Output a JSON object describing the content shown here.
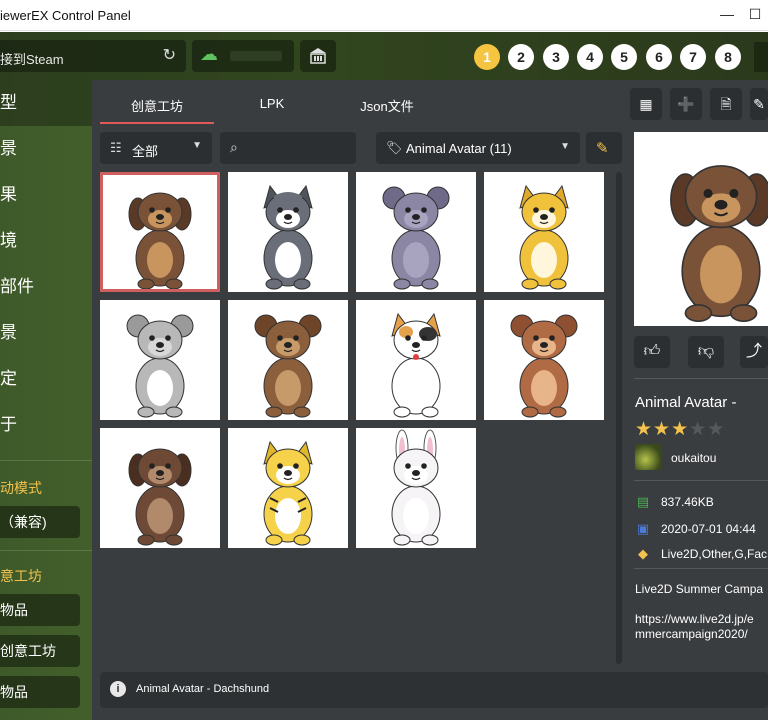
{
  "window": {
    "title": "iewerEX Control Panel",
    "minimize": "—",
    "maximize": "☐"
  },
  "topbar": {
    "steam_status": "接到Steam",
    "profile_numbers": [
      "1",
      "2",
      "3",
      "4",
      "5",
      "6",
      "7",
      "8"
    ],
    "active_profile": "1"
  },
  "sidebar": {
    "items": [
      "型",
      "景",
      "果",
      "境",
      "部件",
      "景",
      "定",
      "于"
    ],
    "active_index": 0,
    "mode_section_label": "动模式",
    "mode_button": "（兼容)",
    "workshop_section_label": "意工坊",
    "workshop_buttons": [
      "物品",
      "创意工坊",
      "物品"
    ]
  },
  "tabs": [
    "创意工坊",
    "LPK",
    "Json文件"
  ],
  "active_tab": "创意工坊",
  "filters": {
    "category": "全部",
    "search_placeholder": "",
    "tag_filter": "Animal Avatar (11)"
  },
  "grid": {
    "items": [
      {
        "name": "Dachshund",
        "animal": "dog"
      },
      {
        "name": "Husky",
        "animal": "husky"
      },
      {
        "name": "Hippo",
        "animal": "hippo"
      },
      {
        "name": "Fox",
        "animal": "fox"
      },
      {
        "name": "Koala",
        "animal": "koala"
      },
      {
        "name": "Bear",
        "animal": "bear"
      },
      {
        "name": "Cat",
        "animal": "cat"
      },
      {
        "name": "Monkey",
        "animal": "monkey"
      },
      {
        "name": "Tanuki",
        "animal": "tanuki"
      },
      {
        "name": "Tiger",
        "animal": "tiger"
      },
      {
        "name": "Rabbit",
        "animal": "rabbit"
      }
    ],
    "selected_index": 0
  },
  "status": {
    "text": "Animal Avatar - Dachshund"
  },
  "details": {
    "title": "Animal Avatar -",
    "rating": 3,
    "rating_max": 5,
    "author": "oukaitou",
    "size": "837.46KB",
    "date": "2020-07-01 04:44",
    "tags": "Live2D,Other,G,Fac",
    "description_line1": "Live2D Summer Campa",
    "description_line2": "https://www.live2d.jp/e",
    "description_line3": "mmercampaign2020/"
  },
  "colors": {
    "accent_red": "#e05a5a",
    "gold": "#f2c14e",
    "panel_bg": "#3a3d40",
    "green_bg": "#4a6a2c",
    "cloud_green": "#5ec25e",
    "date_icon_blue": "#4b7bd6",
    "size_icon_green": "#4caf50",
    "tag_icon_gold": "#f2c14e"
  },
  "icons": {
    "refresh": "refresh-icon",
    "cloud": "cloud-icon",
    "bank": "workshop-building-icon",
    "tree": "tree-icon",
    "search": "search-icon",
    "tag": "tag-icon",
    "tag_edit": "tag-edit-icon",
    "grid_view": "grid-view-icon",
    "add_file": "add-file-icon",
    "file": "file-icon",
    "edit": "edit-icon",
    "thumbs_up": "thumbs-up-icon",
    "thumbs_down": "thumbs-down-icon",
    "share": "share-icon",
    "info": "info-icon"
  }
}
